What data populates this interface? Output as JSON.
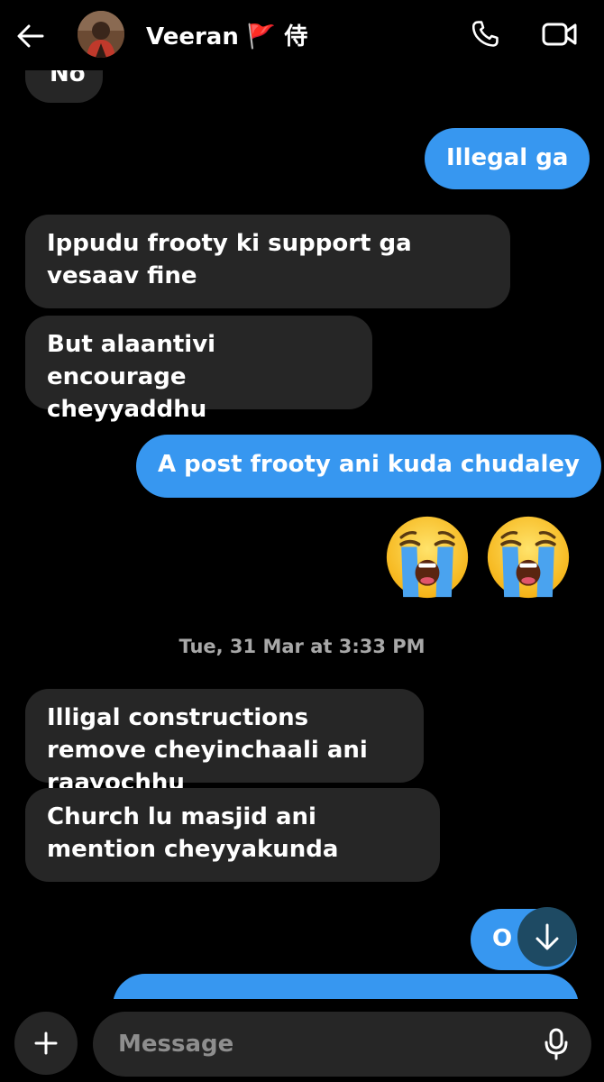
{
  "header": {
    "contact_name": "Veeran 🚩 侍",
    "back_icon": "arrow-left-icon",
    "call_icon": "phone-icon",
    "video_icon": "video-camera-icon"
  },
  "messages": [
    {
      "side": "in",
      "text": "No"
    },
    {
      "side": "out",
      "text": "Illegal ga"
    },
    {
      "side": "in",
      "text": "Ippudu frooty ki support ga vesaav fine"
    },
    {
      "side": "in",
      "text": "But alaantivi encourage cheyyaddhu"
    },
    {
      "side": "out",
      "text": "A post frooty ani kuda chudaley"
    },
    {
      "side": "out",
      "type": "emoji",
      "text": "😭😭"
    },
    {
      "side": "in",
      "text": "Illigal constructions remove cheyinchaali ani raayochhu"
    },
    {
      "side": "in",
      "text": "Church lu masjid ani mention cheyyakunda"
    },
    {
      "side": "out",
      "text": "O"
    }
  ],
  "timestamp": "Tue, 31 Mar at 3:33 PM",
  "composer": {
    "placeholder": "Message",
    "plus_icon": "plus-icon",
    "mic_icon": "microphone-icon"
  },
  "scroll_button_icon": "arrow-down-icon",
  "colors": {
    "background": "#000000",
    "incoming_bubble": "#262626",
    "outgoing_bubble": "#3797f0",
    "timestamp": "#a8a8a8"
  }
}
